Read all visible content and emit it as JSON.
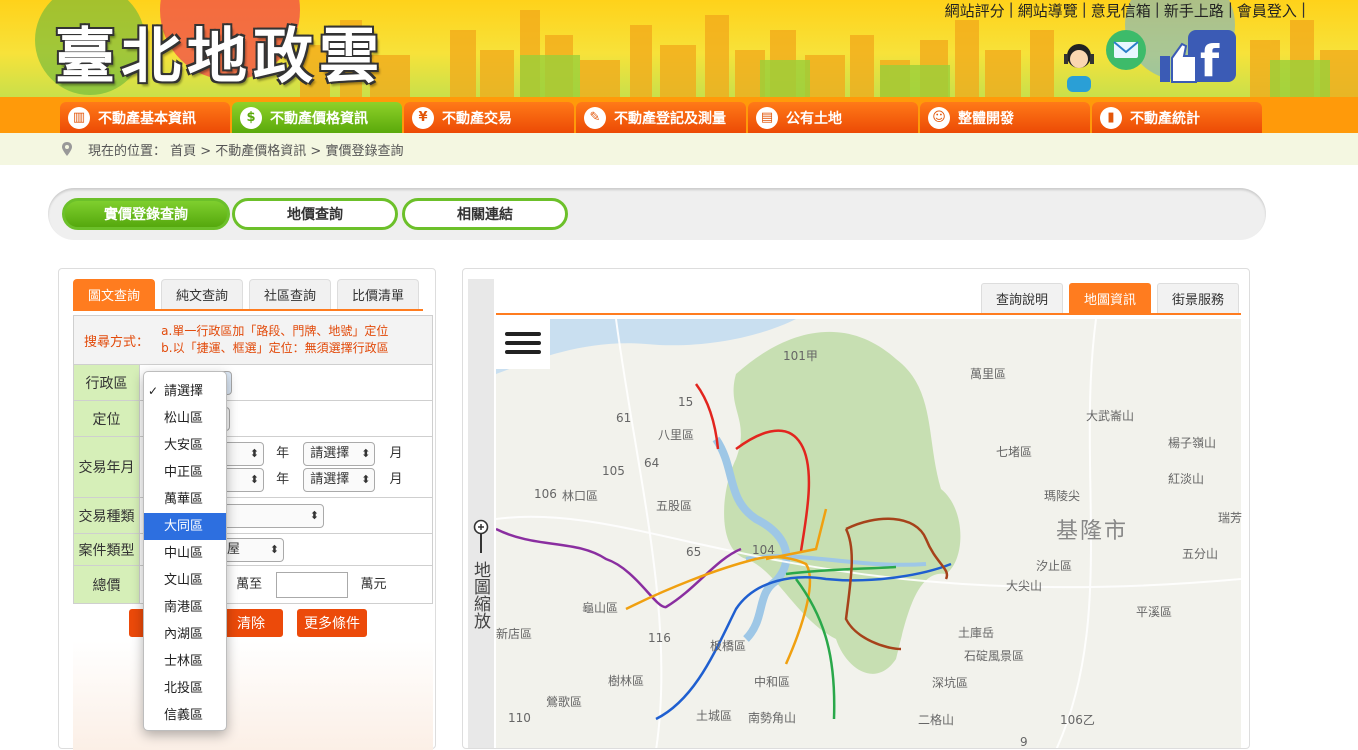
{
  "header": {
    "logo_text": "臺北地政雲",
    "top_links": [
      "網站評分",
      "網站導覽",
      "意見信箱",
      "新手上路",
      "會員登入"
    ]
  },
  "nav": [
    {
      "label": "不動產基本資訊",
      "icon": "building-icon"
    },
    {
      "label": "不動產價格資訊",
      "icon": "price-tag-icon"
    },
    {
      "label": "不動產交易",
      "icon": "money-icon"
    },
    {
      "label": "不動產登記及測量",
      "icon": "survey-icon"
    },
    {
      "label": "公有土地",
      "icon": "land-icon"
    },
    {
      "label": "整體開發",
      "icon": "development-icon"
    },
    {
      "label": "不動產統計",
      "icon": "statistics-icon"
    }
  ],
  "breadcrumb": "現在的位置： 首頁 > 不動產價格資訊 > 實價登錄查詢",
  "subtabs": [
    "實價登錄查詢",
    "地價查詢",
    "相關連結"
  ],
  "left_panel": {
    "tabs": [
      "圖文查詢",
      "純文查詢",
      "社區查詢",
      "比價清單"
    ],
    "search_label": "搜尋方式：",
    "search_line_a": "a.單一行政區加「路段、門牌、地號」定位",
    "search_line_b": "b.以「捷運、框選」定位：無須選擇行政區",
    "fields": {
      "district": "行政區",
      "locate": "定位",
      "trade_period": "交易年月",
      "trade_type": "交易種類",
      "case_type": "案件類型",
      "total_price": "總價"
    },
    "year_unit": "年",
    "month_unit": "月",
    "month_select": "請選擇",
    "case_type_value": "屋",
    "price_from_unit": "萬至",
    "price_to_unit": "萬元",
    "clear_button": "清除",
    "more_button": "更多條件"
  },
  "dropdown": {
    "options": [
      "請選擇",
      "松山區",
      "大安區",
      "中正區",
      "萬華區",
      "大同區",
      "中山區",
      "文山區",
      "南港區",
      "內湖區",
      "士林區",
      "北投區",
      "信義區"
    ],
    "checked": "請選擇",
    "highlighted": "大同區"
  },
  "map_panel": {
    "tabs": [
      "查詢說明",
      "地圖資訊",
      "街景服務"
    ],
    "zoom_label": "地圖縮放",
    "labels": [
      "萬里區",
      "八里區",
      "林口區",
      "五股區",
      "七堵區",
      "大武崙山",
      "楊子嶺山",
      "紅淡山",
      "瑞芳",
      "基隆市",
      "瑪陵尖",
      "汐止區",
      "大尖山",
      "五分山",
      "平溪區",
      "土庫岳",
      "石碇風景區",
      "深坑區",
      "二格山",
      "龜山區",
      "樹林區",
      "鶯歌區",
      "土城區",
      "中和區",
      "南勢角山",
      "新店區",
      "板橋區"
    ],
    "road_shields": [
      "101甲",
      "15",
      "61",
      "105",
      "106",
      "64",
      "104",
      "65",
      "116",
      "110",
      "9",
      "106乙"
    ]
  }
}
